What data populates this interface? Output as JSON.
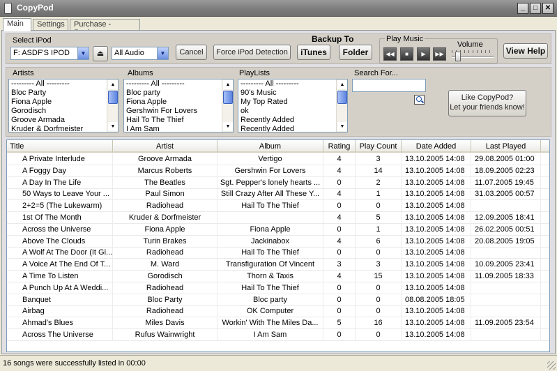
{
  "window": {
    "title": "CopyPod"
  },
  "tabs": [
    {
      "label": "Main",
      "active": true
    },
    {
      "label": "Settings",
      "active": false
    },
    {
      "label": "Purchase - Register",
      "active": false
    }
  ],
  "toolbar": {
    "select_ipod_label": "Select iPod",
    "ipod_selected": "F: ASDF'S IPOD",
    "audio_filter_selected": "All Audio",
    "cancel_label": "Cancel",
    "force_detection_label": "Force iPod Detection",
    "backup_to_label": "Backup To",
    "itunes_label": "iTunes",
    "folder_label": "Folder",
    "play_music_label": "Play Music",
    "volume_label": "Volume",
    "view_help_label": "View Help",
    "volume_level": 0.1
  },
  "filters": {
    "artists_label": "Artists",
    "artists": [
      "--------- All ---------",
      "Bloc Party",
      "Fiona Apple",
      "Gorodisch",
      "Groove Armada",
      "Kruder & Dorfmeister"
    ],
    "albums_label": "Albums",
    "albums": [
      "--------- All ---------",
      "Bloc party",
      "Fiona Apple",
      "Gershwin For Lovers",
      "Hail To The Thief",
      "I Am Sam"
    ],
    "playlists_label": "PlayLists",
    "playlists": [
      "--------- All ---------",
      "90's Music",
      "My Top Rated",
      "ok",
      "Recently Added",
      "Recently Added"
    ],
    "search_label": "Search For...",
    "search_value": "",
    "like_line1": "Like CopyPod?",
    "like_line2": "Let your friends know!"
  },
  "table": {
    "columns": [
      "Title",
      "Artist",
      "Album",
      "Rating",
      "Play Count",
      "Date Added",
      "Last Played"
    ],
    "rows": [
      [
        "A Private Interlude",
        "Groove Armada",
        "Vertigo",
        "4",
        "3",
        "13.10.2005  14:08",
        "29.08.2005  01:00"
      ],
      [
        "A Foggy Day",
        "Marcus Roberts",
        "Gershwin For Lovers",
        "4",
        "14",
        "13.10.2005  14:08",
        "18.09.2005  02:23"
      ],
      [
        "A Day In The Life",
        "The Beatles",
        "Sgt. Pepper's lonely hearts ...",
        "0",
        "2",
        "13.10.2005  14:08",
        "11.07.2005  19:45"
      ],
      [
        "50 Ways to Leave Your ...",
        "Paul Simon",
        "Still Crazy After All These Y...",
        "4",
        "1",
        "13.10.2005  14:08",
        "31.03.2005  00:57"
      ],
      [
        "2+2=5 (The Lukewarm)",
        "Radiohead",
        "Hail To The Thief",
        "0",
        "0",
        "13.10.2005  14:08",
        ""
      ],
      [
        "1st Of The Month",
        "Kruder & Dorfmeister",
        "",
        "4",
        "5",
        "13.10.2005  14:08",
        "12.09.2005  18:41"
      ],
      [
        "Across the Universe",
        "Fiona Apple",
        "Fiona Apple",
        "0",
        "1",
        "13.10.2005  14:08",
        "26.02.2005  00:51"
      ],
      [
        "Above The Clouds",
        "Turin Brakes",
        "Jackinabox",
        "4",
        "6",
        "13.10.2005  14:08",
        "20.08.2005  19:05"
      ],
      [
        "A Wolf At The Door (It Gi...",
        "Radiohead",
        "Hail To The Thief",
        "0",
        "0",
        "13.10.2005  14:08",
        ""
      ],
      [
        "A Voice At The End Of T...",
        "M. Ward",
        "Transfiguration Of Vincent",
        "3",
        "3",
        "13.10.2005  14:08",
        "10.09.2005  23:41"
      ],
      [
        "A Time To Listen",
        "Gorodisch",
        "Thorn & Taxis",
        "4",
        "15",
        "13.10.2005  14:08",
        "11.09.2005  18:33"
      ],
      [
        "A Punch Up At A Weddi...",
        "Radiohead",
        "Hail To The Thief",
        "0",
        "0",
        "13.10.2005  14:08",
        ""
      ],
      [
        "Banquet",
        "Bloc Party",
        "Bloc party",
        "0",
        "0",
        "08.08.2005  18:05",
        ""
      ],
      [
        "Airbag",
        "Radiohead",
        "OK Computer",
        "0",
        "0",
        "13.10.2005  14:08",
        ""
      ],
      [
        "Ahmad's Blues",
        "Miles Davis",
        "Workin' With The Miles Da...",
        "5",
        "16",
        "13.10.2005  14:08",
        "11.09.2005  23:54"
      ],
      [
        "Across The Universe",
        "Rufus Wainwright",
        "I Am Sam",
        "0",
        "0",
        "13.10.2005  14:08",
        ""
      ]
    ]
  },
  "status": {
    "text": "16 songs were successfully listed in 00:00"
  }
}
